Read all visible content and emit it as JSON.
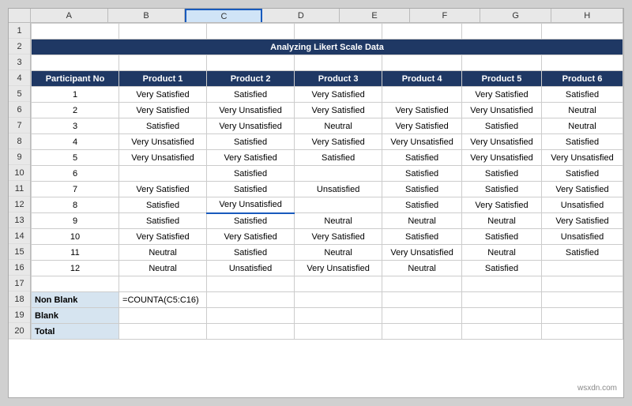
{
  "title": "Analyzing Likert Scale Data",
  "columns": [
    "A",
    "B",
    "C",
    "D",
    "E",
    "F",
    "G",
    "H"
  ],
  "row_numbers": [
    "1",
    "2",
    "3",
    "4",
    "5",
    "6",
    "7",
    "8",
    "9",
    "10",
    "11",
    "12",
    "13",
    "14",
    "15",
    "16",
    "17",
    "18",
    "19",
    "20"
  ],
  "headers": {
    "participantNo": "Participant No",
    "product1": "Product 1",
    "product2": "Product 2",
    "product3": "Product 3",
    "product4": "Product 4",
    "product5": "Product 5",
    "product6": "Product 6"
  },
  "rows": [
    {
      "no": "1",
      "p1": "Very Satisfied",
      "p2": "Satisfied",
      "p3": "Very Satisfied",
      "p4": "",
      "p5": "Very Satisfied",
      "p6": "Satisfied"
    },
    {
      "no": "2",
      "p1": "Very Satisfied",
      "p2": "Very Unsatisfied",
      "p3": "Very Satisfied",
      "p4": "Very Satisfied",
      "p5": "Very Unsatisfied",
      "p6": "Neutral"
    },
    {
      "no": "3",
      "p1": "Satisfied",
      "p2": "Very Unsatisfied",
      "p3": "Neutral",
      "p4": "Very Satisfied",
      "p5": "Satisfied",
      "p6": "Neutral"
    },
    {
      "no": "4",
      "p1": "Very Unsatisfied",
      "p2": "Satisfied",
      "p3": "Very Satisfied",
      "p4": "Very Unsatisfied",
      "p5": "Very Unsatisfied",
      "p6": "Satisfied"
    },
    {
      "no": "5",
      "p1": "Very Unsatisfied",
      "p2": "Very Satisfied",
      "p3": "Satisfied",
      "p4": "Satisfied",
      "p5": "Very Unsatisfied",
      "p6": "Very Unsatisfied"
    },
    {
      "no": "6",
      "p1": "",
      "p2": "Satisfied",
      "p3": "",
      "p4": "Satisfied",
      "p5": "Satisfied",
      "p6": "Satisfied"
    },
    {
      "no": "7",
      "p1": "Very Satisfied",
      "p2": "Satisfied",
      "p3": "Unsatisfied",
      "p4": "Satisfied",
      "p5": "Satisfied",
      "p6": "Very Satisfied"
    },
    {
      "no": "8",
      "p1": "Satisfied",
      "p2": "Very Unsatisfied",
      "p3": "",
      "p4": "Satisfied",
      "p5": "Very Satisfied",
      "p6": "Unsatisfied"
    },
    {
      "no": "9",
      "p1": "Satisfied",
      "p2": "Satisfied",
      "p3": "Neutral",
      "p4": "Neutral",
      "p5": "Neutral",
      "p6": "Very Satisfied"
    },
    {
      "no": "10",
      "p1": "Very Satisfied",
      "p2": "Very Satisfied",
      "p3": "Very Satisfied",
      "p4": "Satisfied",
      "p5": "Satisfied",
      "p6": "Unsatisfied"
    },
    {
      "no": "11",
      "p1": "Neutral",
      "p2": "Satisfied",
      "p3": "Neutral",
      "p4": "Very Unsatisfied",
      "p5": "Neutral",
      "p6": "Satisfied"
    },
    {
      "no": "12",
      "p1": "Neutral",
      "p2": "Unsatisfied",
      "p3": "Very Unsatisfied",
      "p4": "Neutral",
      "p5": "Satisfied",
      "p6": ""
    }
  ],
  "summary": {
    "nonBlankLabel": "Non Blank",
    "blankLabel": "Blank",
    "totalLabel": "Total",
    "nonBlankFormula": "=COUNTA(C5:C16)"
  },
  "watermark": "wsxdn.com"
}
